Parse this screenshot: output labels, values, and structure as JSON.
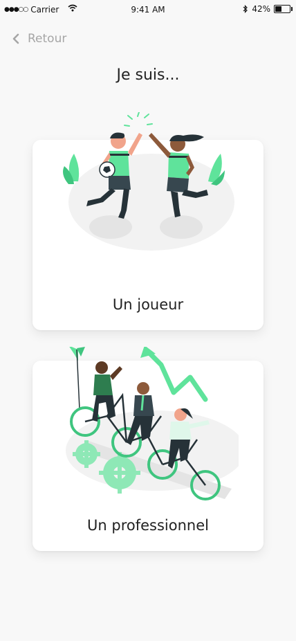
{
  "status_bar": {
    "carrier": "Carrier",
    "time": "9:41 AM",
    "battery_percent": "42%",
    "battery_level": 0.42
  },
  "nav": {
    "back_label": "Retour"
  },
  "page": {
    "title": "Je suis..."
  },
  "choices": [
    {
      "label": "Un joueur",
      "illustration": "soccer-players-high-five"
    },
    {
      "label": "Un professionnel",
      "illustration": "team-cycling-growth"
    }
  ],
  "colors": {
    "accent": "#5fe39b",
    "accent_dark": "#263238",
    "background": "#f8f8f8",
    "card": "#ffffff",
    "muted_text": "#a6a6a6"
  }
}
